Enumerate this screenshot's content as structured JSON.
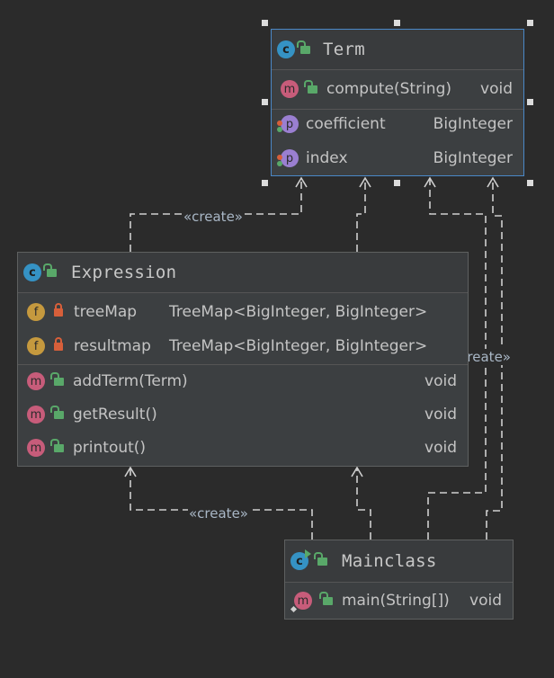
{
  "classes": {
    "term": {
      "name": "Term",
      "methods": [
        {
          "name": "compute(String)",
          "type": "void"
        }
      ],
      "fields": [
        {
          "name": "coefficient",
          "type": "BigInteger"
        },
        {
          "name": "index",
          "type": "BigInteger"
        }
      ]
    },
    "expression": {
      "name": "Expression",
      "fields": [
        {
          "name": "treeMap",
          "type": "TreeMap<BigInteger, BigInteger>"
        },
        {
          "name": "resultmap",
          "type": "TreeMap<BigInteger, BigInteger>"
        }
      ],
      "methods": [
        {
          "name": "addTerm(Term)",
          "type": "void"
        },
        {
          "name": "getResult()",
          "type": "void"
        },
        {
          "name": "printout()",
          "type": "void"
        }
      ]
    },
    "mainclass": {
      "name": "Mainclass",
      "methods": [
        {
          "name": "main(String[])",
          "type": "void"
        }
      ]
    }
  },
  "edge_labels": {
    "expression_term": "«create»",
    "main_term": "«create»",
    "main_expression": "«create»"
  },
  "icons": {
    "class": "c",
    "method": "m",
    "property": "p",
    "field": "f"
  },
  "colors": {
    "background": "#2b2b2b",
    "selection_border": "#4a88c7",
    "class_badge": "#3592c4",
    "method_badge": "#c75c7a",
    "property_badge": "#9a7fd1",
    "field_badge": "#c5993e"
  }
}
